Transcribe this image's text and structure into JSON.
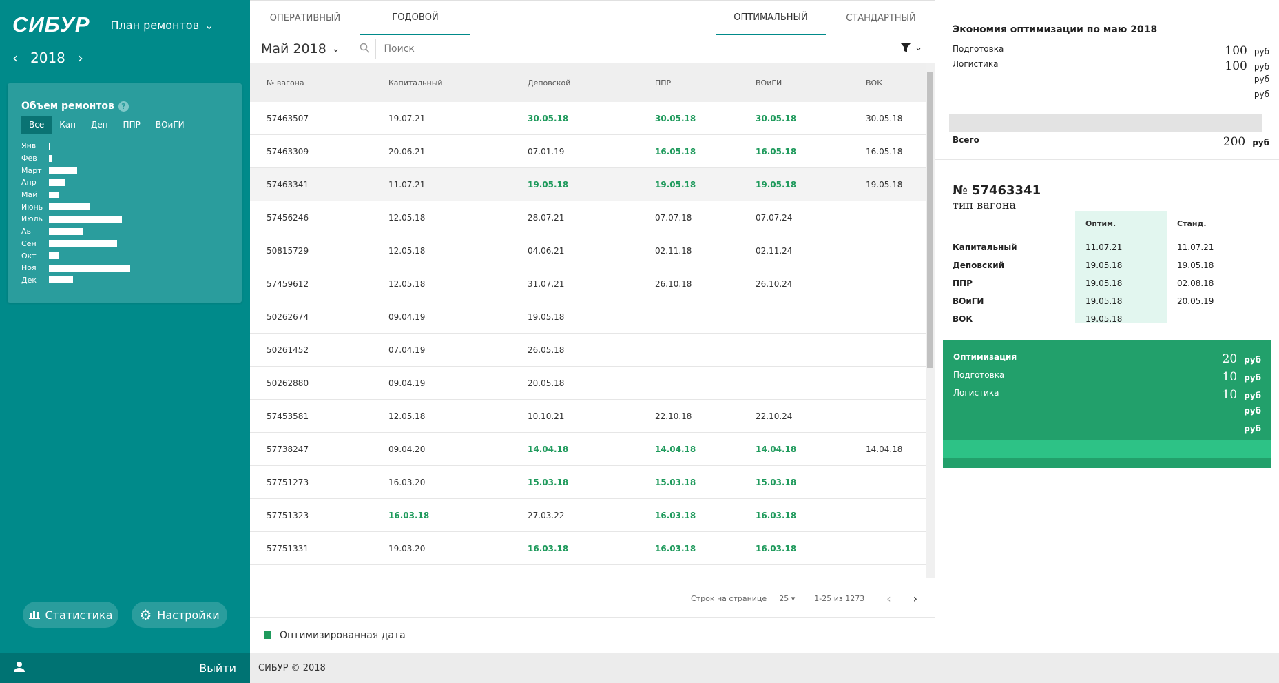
{
  "brand": {
    "logo": "СИБУР"
  },
  "plan_menu": {
    "label": "План ремонтов"
  },
  "year": {
    "value": "2018"
  },
  "volume": {
    "title": "Объем ремонтов",
    "tabs": [
      "Все",
      "Кап",
      "Деп",
      "ППР",
      "ВОиГИ"
    ],
    "months": [
      {
        "label": "Янв",
        "value": 0.01
      },
      {
        "label": "Фев",
        "value": 0.03
      },
      {
        "label": "Март",
        "value": 0.35
      },
      {
        "label": "Апр",
        "value": 0.2
      },
      {
        "label": "Май",
        "value": 0.13
      },
      {
        "label": "Июнь",
        "value": 0.5
      },
      {
        "label": "Июль",
        "value": 0.9
      },
      {
        "label": "Авг",
        "value": 0.42
      },
      {
        "label": "Сен",
        "value": 0.84
      },
      {
        "label": "Окт",
        "value": 0.12
      },
      {
        "label": "Ноя",
        "value": 1.0
      },
      {
        "label": "Дек",
        "value": 0.3
      }
    ]
  },
  "sidebar_buttons": {
    "stats": "Статистика",
    "settings": "Настройки"
  },
  "logout": "Выйти",
  "tabs": {
    "operational": "Оперативный",
    "annual": "Годовой",
    "optimal": "Оптимальный",
    "standard": "Стандартный"
  },
  "month_select": "Май 2018",
  "search": {
    "placeholder": "Поиск"
  },
  "table": {
    "headers": [
      "№ вагона",
      "Капитальный",
      "Деповской",
      "ППР",
      "ВОиГИ",
      "ВОК"
    ],
    "rows": [
      {
        "cells": [
          "57463507",
          "19.07.21",
          "30.05.18",
          "30.05.18",
          "30.05.18",
          "30.05.18"
        ],
        "opt": [
          false,
          false,
          true,
          true,
          true,
          false
        ]
      },
      {
        "cells": [
          "57463309",
          "20.06.21",
          "07.01.19",
          "16.05.18",
          "16.05.18",
          "16.05.18"
        ],
        "opt": [
          false,
          false,
          false,
          true,
          true,
          false
        ]
      },
      {
        "cells": [
          "57463341",
          "11.07.21",
          "19.05.18",
          "19.05.18",
          "19.05.18",
          "19.05.18"
        ],
        "opt": [
          false,
          false,
          true,
          true,
          true,
          false
        ],
        "selected": true
      },
      {
        "cells": [
          "57456246",
          "12.05.18",
          "28.07.21",
          "07.07.18",
          "07.07.24",
          ""
        ],
        "opt": [
          false,
          false,
          false,
          false,
          false,
          false
        ]
      },
      {
        "cells": [
          "50815729",
          "12.05.18",
          "04.06.21",
          "02.11.18",
          "02.11.24",
          ""
        ],
        "opt": [
          false,
          false,
          false,
          false,
          false,
          false
        ]
      },
      {
        "cells": [
          "57459612",
          "12.05.18",
          "31.07.21",
          "26.10.18",
          "26.10.24",
          ""
        ],
        "opt": [
          false,
          false,
          false,
          false,
          false,
          false
        ]
      },
      {
        "cells": [
          "50262674",
          "09.04.19",
          "19.05.18",
          "",
          "",
          ""
        ],
        "opt": [
          false,
          false,
          false,
          false,
          false,
          false
        ]
      },
      {
        "cells": [
          "50261452",
          "07.04.19",
          "26.05.18",
          "",
          "",
          ""
        ],
        "opt": [
          false,
          false,
          false,
          false,
          false,
          false
        ]
      },
      {
        "cells": [
          "50262880",
          "09.04.19",
          "20.05.18",
          "",
          "",
          ""
        ],
        "opt": [
          false,
          false,
          false,
          false,
          false,
          false
        ]
      },
      {
        "cells": [
          "57453581",
          "12.05.18",
          "10.10.21",
          "22.10.18",
          "22.10.24",
          ""
        ],
        "opt": [
          false,
          false,
          false,
          false,
          false,
          false
        ]
      },
      {
        "cells": [
          "57738247",
          "09.04.20",
          "14.04.18",
          "14.04.18",
          "14.04.18",
          "14.04.18"
        ],
        "opt": [
          false,
          false,
          true,
          true,
          true,
          false
        ]
      },
      {
        "cells": [
          "57751273",
          "16.03.20",
          "15.03.18",
          "15.03.18",
          "15.03.18",
          ""
        ],
        "opt": [
          false,
          false,
          true,
          true,
          true,
          false
        ]
      },
      {
        "cells": [
          "57751323",
          "16.03.18",
          "27.03.22",
          "16.03.18",
          "16.03.18",
          ""
        ],
        "opt": [
          false,
          true,
          false,
          true,
          true,
          false
        ]
      },
      {
        "cells": [
          "57751331",
          "19.03.20",
          "16.03.18",
          "16.03.18",
          "16.03.18",
          ""
        ],
        "opt": [
          false,
          false,
          true,
          true,
          true,
          false
        ]
      },
      {
        "cells": [
          "",
          "",
          "",
          "",
          "",
          ""
        ],
        "opt": [
          false,
          false,
          false,
          false,
          false,
          false
        ]
      }
    ]
  },
  "pagination": {
    "rows_label": "Строк на странице",
    "rows_value": "25",
    "range": "1-25 из 1273"
  },
  "legend": "Оптимизированная дата",
  "footer": "СИБУР © 2018",
  "economy": {
    "title": "Экономия оптимизации по маю 2018",
    "rows": [
      {
        "label": "Подготовка",
        "value": "100",
        "unit": "руб"
      },
      {
        "label": "Логистика",
        "value": "100",
        "unit": "руб"
      },
      {
        "label": "",
        "value": "",
        "unit": "руб"
      },
      {
        "label": "",
        "value": "",
        "unit": "руб"
      }
    ],
    "total": {
      "label": "Всего",
      "value": "200",
      "unit": "руб"
    }
  },
  "wagon": {
    "number": "№ 57463341",
    "type": "тип вагона",
    "col_opt": "Оптим.",
    "col_std": "Станд.",
    "rows": [
      {
        "label": "Капитальный",
        "opt": "11.07.21",
        "std": "11.07.21"
      },
      {
        "label": "Деповский",
        "opt": "19.05.18",
        "std": "19.05.18"
      },
      {
        "label": "ППР",
        "opt": "19.05.18",
        "std": "02.08.18"
      },
      {
        "label": "ВОиГИ",
        "opt": "19.05.18",
        "std": "20.05.19"
      },
      {
        "label": "ВОК",
        "opt": "19.05.18",
        "std": ""
      }
    ]
  },
  "optimization": {
    "rows": [
      {
        "label": "Оптимизация",
        "value": "20",
        "unit": "руб",
        "bold": true
      },
      {
        "label": "Подготовка",
        "value": "10",
        "unit": "руб"
      },
      {
        "label": "Логистика",
        "value": "10",
        "unit": "руб"
      },
      {
        "label": "",
        "value": "",
        "unit": "руб"
      },
      {
        "label": "",
        "value": "",
        "unit": "руб"
      }
    ]
  },
  "colors": {
    "sidebar": "#008a8a",
    "card": "#2a9d9d",
    "opt_green": "#1f9a5c",
    "opt_card": "#22a06b"
  }
}
